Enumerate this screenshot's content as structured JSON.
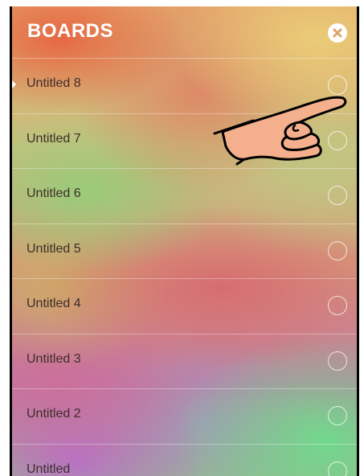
{
  "header": {
    "title": "BOARDS",
    "close_icon": "close-icon"
  },
  "boards": [
    {
      "label": "Untitled 8",
      "active": true
    },
    {
      "label": "Untitled 7",
      "active": false
    },
    {
      "label": "Untitled 6",
      "active": false
    },
    {
      "label": "Untitled 5",
      "active": false
    },
    {
      "label": "Untitled 4",
      "active": false
    },
    {
      "label": "Untitled 3",
      "active": false
    },
    {
      "label": "Untitled 2",
      "active": false
    },
    {
      "label": "Untitled",
      "active": false
    }
  ],
  "overlay": {
    "icon": "pointing-hand-icon"
  }
}
